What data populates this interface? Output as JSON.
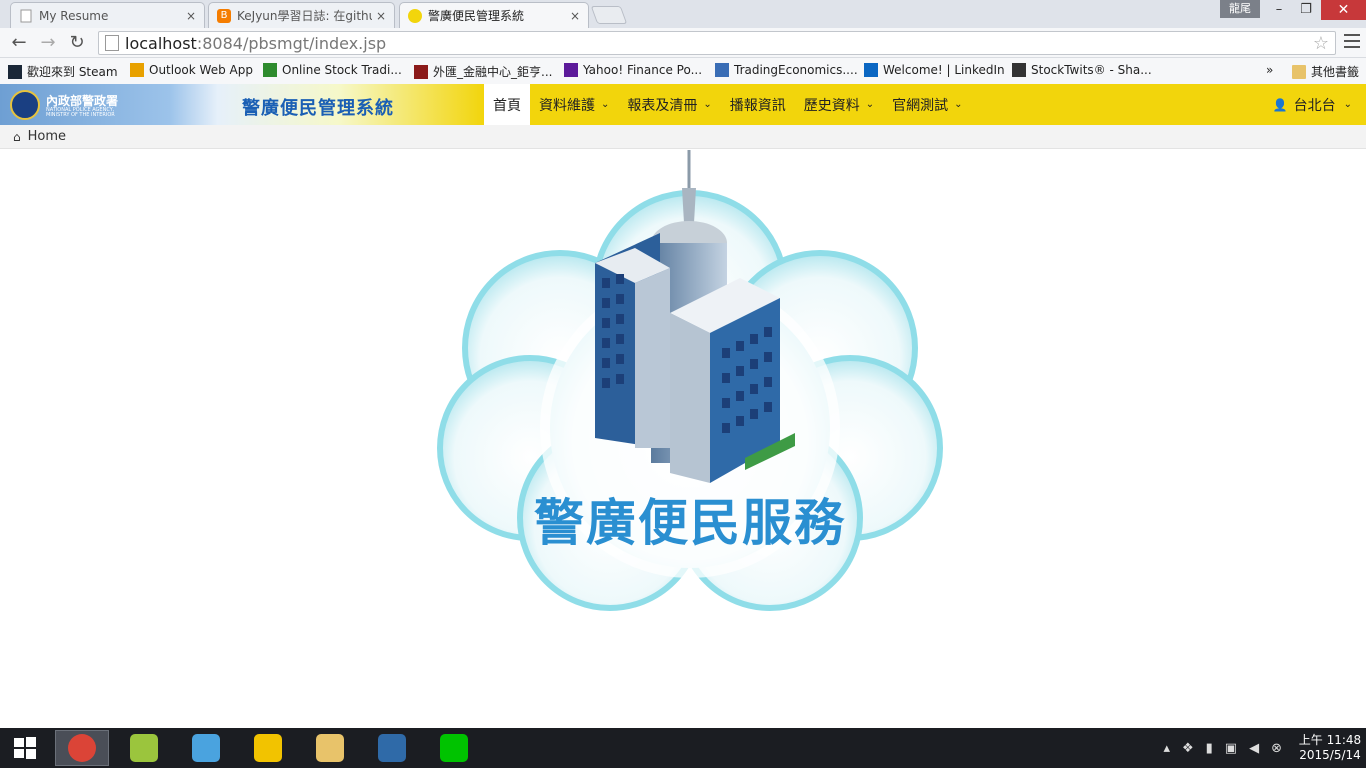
{
  "browser": {
    "tabs": [
      {
        "title": "My Resume",
        "close": "×"
      },
      {
        "title": "KeJyun學習日誌: 在githul",
        "close": "×"
      },
      {
        "title": "警廣便民管理系統",
        "close": "×"
      }
    ],
    "window_user": "龍尾",
    "url_host": "localhost",
    "url_rest": ":8084/pbsmgt/index.jsp",
    "bookmarks": [
      {
        "label": "歡迎來到 Steam",
        "icon": "steam-icon",
        "color": "#1b2838"
      },
      {
        "label": "Outlook Web App",
        "icon": "outlook-icon",
        "color": "#e8a100"
      },
      {
        "label": "Online Stock Tradi...",
        "icon": "td-icon",
        "color": "#2e8b2e"
      },
      {
        "label": "外匯_金融中心_鉅亨...",
        "icon": "cnyes-icon",
        "color": "#8b1a1a"
      },
      {
        "label": "Yahoo! Finance Po...",
        "icon": "yahoo-icon",
        "color": "#5c1a9a"
      },
      {
        "label": "TradingEconomics....",
        "icon": "tradingeconomics-icon",
        "color": "#3a6db5"
      },
      {
        "label": "Welcome! | LinkedIn",
        "icon": "linkedin-icon",
        "color": "#0a66c2"
      },
      {
        "label": "StockTwits® - Sha...",
        "icon": "stocktwits-icon",
        "color": "#333333"
      }
    ],
    "bookmarks_more": "»",
    "other_bookmarks": "其他書籤"
  },
  "app": {
    "org_name": "內政部警政署",
    "org_sub": "NATIONAL POLICE AGENCY, MINISTRY OF THE INTERIOR",
    "system_name": "警廣便民管理系統",
    "nav": [
      {
        "label": "首頁",
        "active": true,
        "dropdown": false
      },
      {
        "label": "資料維護",
        "dropdown": true
      },
      {
        "label": "報表及清冊",
        "dropdown": true
      },
      {
        "label": "播報資訊",
        "dropdown": false
      },
      {
        "label": "歷史資料",
        "dropdown": true
      },
      {
        "label": "官網測試",
        "dropdown": true
      }
    ],
    "user": "台北台",
    "breadcrumb": "Home",
    "hero_title": "警廣便民服務"
  },
  "taskbar": {
    "apps": [
      "chrome-icon",
      "netbeans-icon",
      "adgo-icon",
      "tool-icon",
      "explorer-icon",
      "virtualbox-icon",
      "line-icon"
    ],
    "time": "上午 11:48",
    "date": "2015/5/14"
  }
}
